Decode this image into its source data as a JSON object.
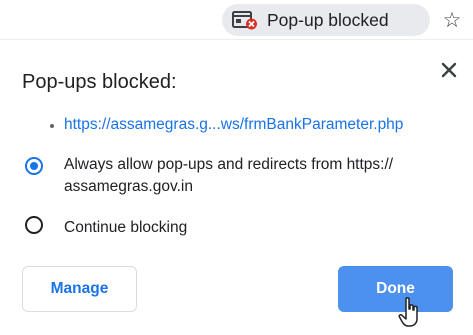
{
  "omnibox": {
    "popup_chip_label": "Pop-up blocked",
    "popup_icon": "popup-blocked-icon",
    "bookmark_icon": "star-icon"
  },
  "dialog": {
    "title": "Pop-ups blocked:",
    "blocked_link": "https://assamegras.g...ws/frmBankParameter.php",
    "options": {
      "allow_label": "Always allow pop-ups and redirects from https://\nassamegras.gov.in",
      "block_label": "Continue blocking",
      "selected": "allow"
    },
    "manage_button": "Manage",
    "done_button": "Done",
    "close_icon": "close-icon"
  },
  "colors": {
    "accent": "#1a73e8",
    "chip_bg": "#e8eaed",
    "blocked_red": "#d93025"
  }
}
